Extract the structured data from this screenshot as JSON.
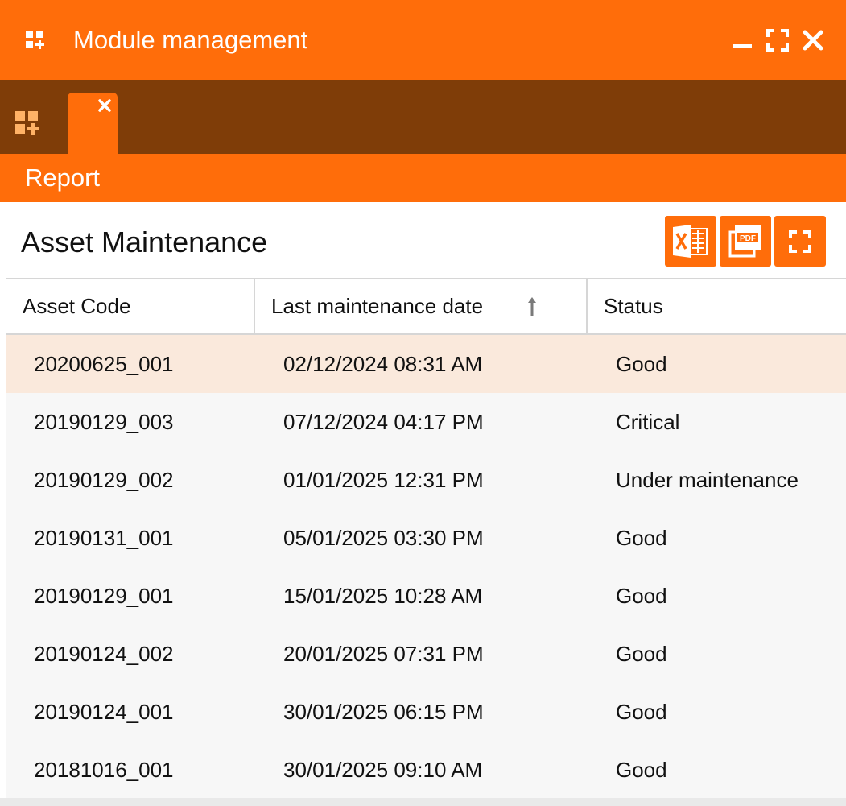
{
  "window": {
    "title": "Module management",
    "app_icon": "widgets-add-icon",
    "controls": [
      "minimize-icon",
      "maximize-icon",
      "close-icon"
    ]
  },
  "tabstrip": {
    "icon": "widgets-add-icon",
    "tabs": [
      {
        "label": "",
        "close_icon": "close-icon",
        "active": true
      }
    ]
  },
  "section": {
    "label": "Report"
  },
  "content": {
    "title": "Asset Maintenance",
    "toolbar": [
      "excel-export-icon",
      "pdf-export-icon",
      "fullscreen-icon"
    ]
  },
  "table": {
    "columns": [
      {
        "label": "Asset Code"
      },
      {
        "label": "Last maintenance date",
        "sort": "ascending"
      },
      {
        "label": "Status"
      }
    ],
    "rows": [
      {
        "code": "20200625_001",
        "date": "02/12/2024 08:31 AM",
        "status": "Good",
        "selected": true
      },
      {
        "code": "20190129_003",
        "date": "07/12/2024 04:17 PM",
        "status": "Critical"
      },
      {
        "code": "20190129_002",
        "date": "01/01/2025 12:31 PM",
        "status": "Under maintenance"
      },
      {
        "code": "20190131_001",
        "date": "05/01/2025 03:30 PM",
        "status": "Good"
      },
      {
        "code": "20190129_001",
        "date": "15/01/2025 10:28 AM",
        "status": "Good"
      },
      {
        "code": "20190124_002",
        "date": "20/01/2025 07:31 PM",
        "status": "Good"
      },
      {
        "code": "20190124_001",
        "date": "30/01/2025 06:15 PM",
        "status": "Good"
      },
      {
        "code": "20181016_001",
        "date": "30/01/2025 09:10 AM",
        "status": "Good"
      }
    ]
  },
  "colors": {
    "accent": "#FF6D0A",
    "tabstrip": "#7F3D08",
    "selected_row": "#FAE9DC",
    "row_bg": "#F7F7F7"
  }
}
